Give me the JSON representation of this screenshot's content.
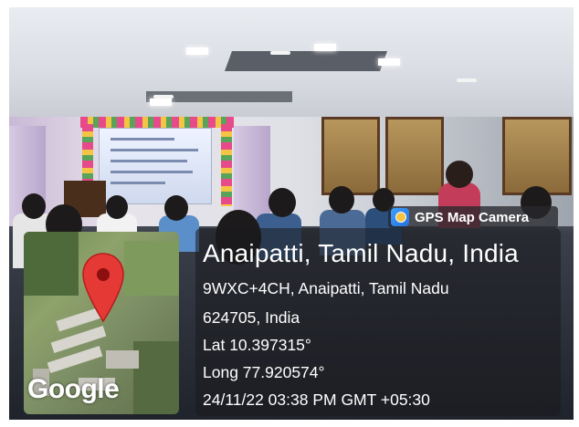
{
  "app_badge": {
    "label": "GPS Map Camera",
    "icon": "gps-map-camera-icon"
  },
  "location": {
    "title": "Anaipatti, Tamil Nadu, India",
    "address_line1": "9WXC+4CH, Anaipatti, Tamil Nadu",
    "address_line2": "624705, India",
    "lat": "Lat 10.397315°",
    "long": "Long 77.920574°",
    "datetime": "24/11/22 03:38 PM GMT +05:30"
  },
  "map": {
    "watermark": "Google",
    "pin_icon": "location-pin-icon"
  },
  "colors": {
    "pin": "#e53935",
    "panel_bg": "rgba(25,25,30,0.55)",
    "badge_bg": "rgba(40,40,45,0.78)"
  }
}
